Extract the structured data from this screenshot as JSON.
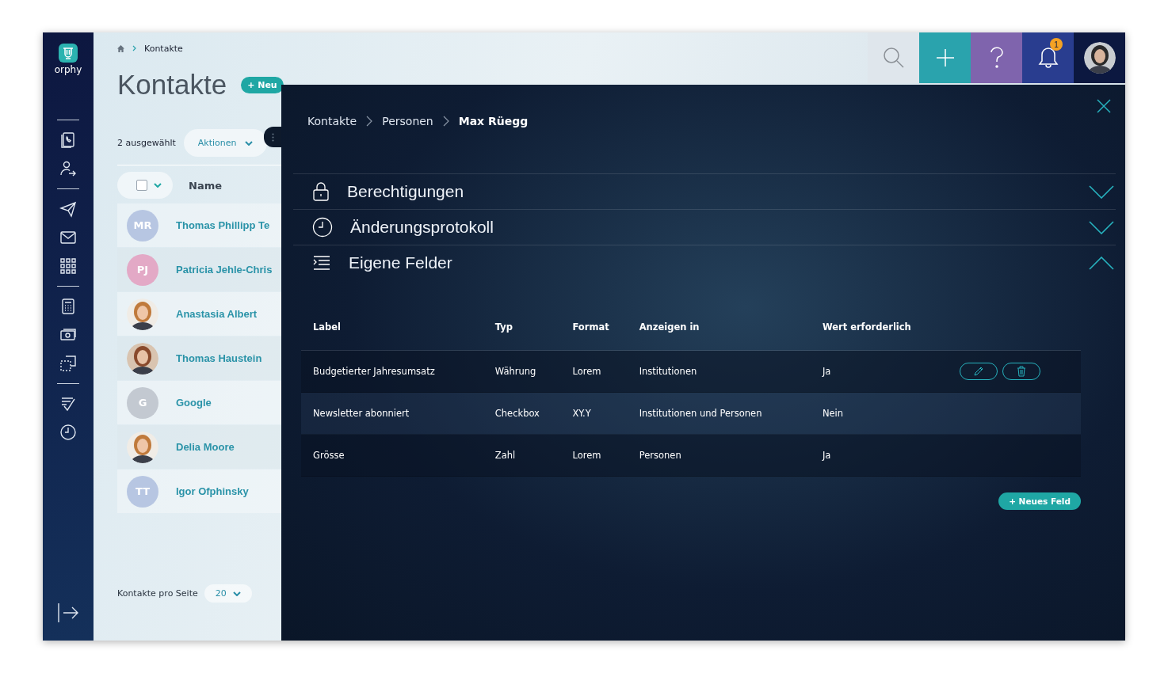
{
  "logo": "orphy",
  "breadcrumb": {
    "current": "Kontakte"
  },
  "page_title": "Kontakte",
  "new_button": "+ Neu",
  "selection": {
    "count_label": "2 ausgewählt",
    "actions": "Aktionen"
  },
  "list": {
    "header": "Name",
    "select_all_checked": false,
    "contacts": [
      {
        "kind": "initials",
        "initials": "MR",
        "color": "#b7c6e2",
        "name": "Thomas Phillipp Te"
      },
      {
        "kind": "initials",
        "initials": "PJ",
        "color": "#e3a9c6",
        "name": "Patricia Jehle-Chris"
      },
      {
        "name": "Anastasia Albert"
      },
      {
        "name": "Thomas Haustein"
      },
      {
        "kind": "initials",
        "initials": "G",
        "color": "#c3c9d1",
        "name": "Google"
      },
      {
        "name": "Delia Moore"
      },
      {
        "kind": "initials",
        "initials": "TT",
        "color": "#b7c6e2",
        "name": "Igor Ofphinsky"
      }
    ]
  },
  "pager": {
    "label": "Kontakte pro Seite",
    "value": "20"
  },
  "notifications": {
    "badge": "1"
  },
  "detail": {
    "breadcrumb": [
      "Kontakte",
      "Personen",
      "Max Rüegg"
    ],
    "sections": [
      {
        "kind": "lock",
        "title": "Berechtigungen",
        "expanded": false
      },
      {
        "kind": "clock",
        "title": "Änderungsprotokoll",
        "expanded": false
      },
      {
        "kind": "list",
        "title": "Eigene Felder",
        "expanded": true
      }
    ],
    "table": {
      "columns": [
        "Label",
        "Typ",
        "Format",
        "Anzeigen in",
        "Wert erforderlich"
      ],
      "rows": [
        {
          "cells": [
            "Budgetierter Jahresumsatz",
            "Währung",
            "Lorem",
            "Institutionen",
            "Ja"
          ],
          "hovered": true
        },
        {
          "cells": [
            "Newsletter abonniert",
            "Checkbox",
            "XY.Y",
            "Institutionen und Personen",
            "Nein"
          ],
          "hovered": false
        },
        {
          "cells": [
            "Grösse",
            "Zahl",
            "Lorem",
            "Personen",
            "Ja"
          ],
          "hovered": false
        }
      ]
    },
    "add_button": "+ Neues Feld"
  }
}
